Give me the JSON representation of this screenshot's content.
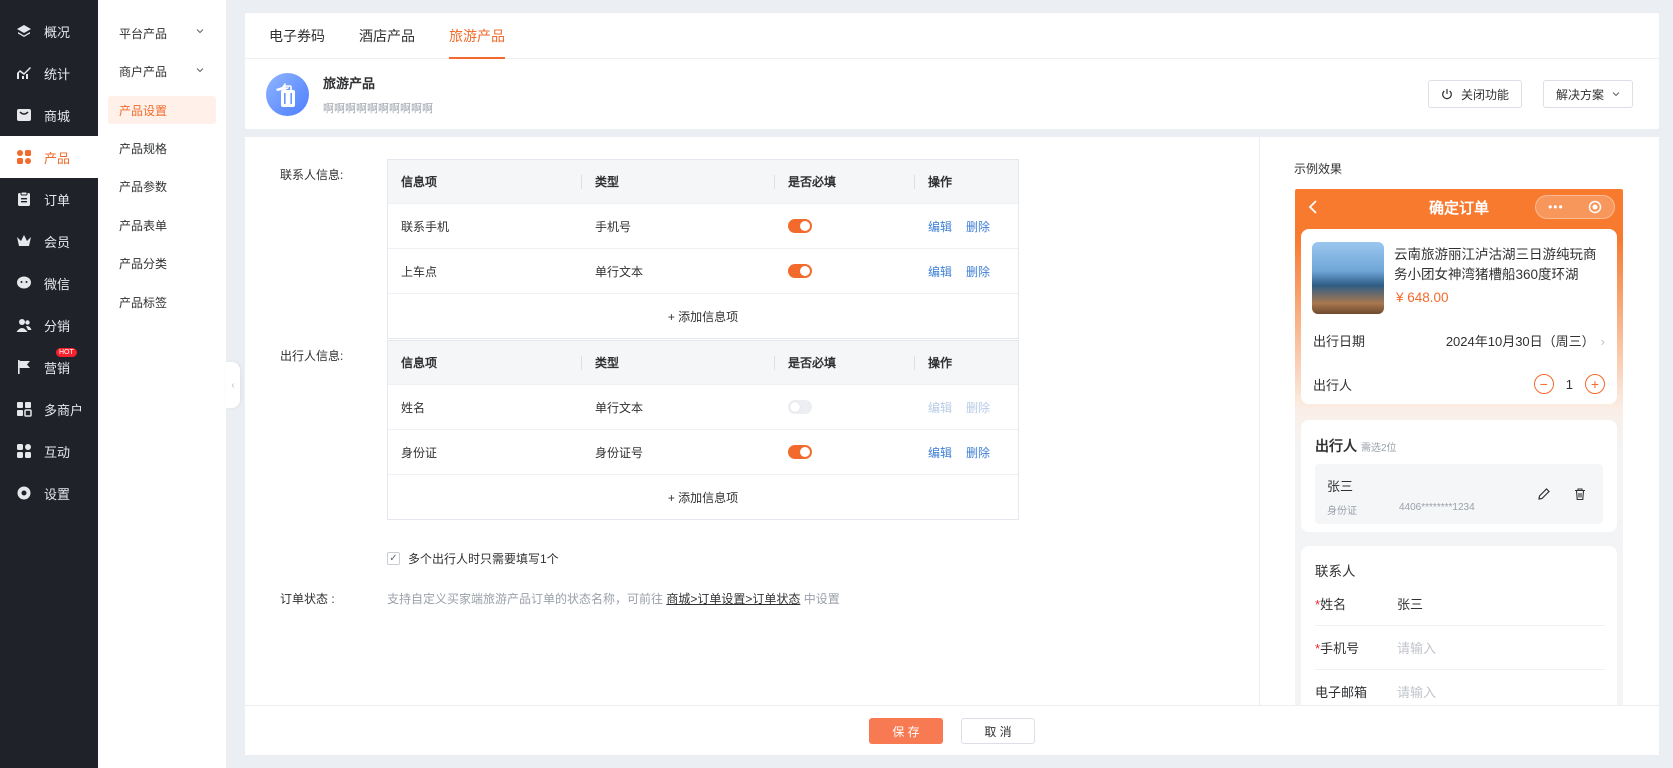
{
  "nav": {
    "items": [
      {
        "label": "概况",
        "icon": "layers-icon"
      },
      {
        "label": "统计",
        "icon": "chart-icon"
      },
      {
        "label": "商城",
        "icon": "shop-icon"
      },
      {
        "label": "产品",
        "icon": "grid-icon",
        "active": true
      },
      {
        "label": "订单",
        "icon": "clipboard-icon"
      },
      {
        "label": "会员",
        "icon": "crown-icon"
      },
      {
        "label": "微信",
        "icon": "wechat-icon"
      },
      {
        "label": "分销",
        "icon": "users-icon"
      },
      {
        "label": "营销",
        "icon": "flag-icon",
        "badge": "HOT"
      },
      {
        "label": "多商户",
        "icon": "store-icon"
      },
      {
        "label": "互动",
        "icon": "apps-icon"
      },
      {
        "label": "设置",
        "icon": "gear-icon"
      }
    ]
  },
  "subnav": {
    "items": [
      "平台产品",
      "商户产品",
      "产品设置",
      "产品规格",
      "产品参数",
      "产品表单",
      "产品分类",
      "产品标签"
    ]
  },
  "tabs": [
    "电子券码",
    "酒店产品",
    "旅游产品"
  ],
  "feature": {
    "title": "旅游产品",
    "desc": "啊啊啊啊啊啊啊啊啊啊",
    "close_label": "关闭功能",
    "plan_label": "解决方案"
  },
  "contact": {
    "label": "联系人信息:",
    "headers": [
      "信息项",
      "类型",
      "是否必填",
      "操作"
    ],
    "rows": [
      {
        "item": "联系手机",
        "type": "手机号",
        "required": true,
        "edit": "编辑",
        "del": "删除"
      },
      {
        "item": "上车点",
        "type": "单行文本",
        "required": true,
        "edit": "编辑",
        "del": "删除"
      }
    ],
    "add": "+ 添加信息项"
  },
  "traveler": {
    "label": "出行人信息:",
    "headers": [
      "信息项",
      "类型",
      "是否必填",
      "操作"
    ],
    "rows": [
      {
        "item": "姓名",
        "type": "单行文本",
        "required": false,
        "edit": "编辑",
        "del": "删除"
      },
      {
        "item": "身份证",
        "type": "身份证号",
        "required": true,
        "edit": "编辑",
        "del": "删除"
      }
    ],
    "add": "+ 添加信息项"
  },
  "multi_check": "多个出行人时只需要填写1个",
  "order_status": {
    "label": "订单状态 :",
    "desc_pre": "支持自定义买家端旅游产品订单的状态名称，可前往 ",
    "link": "商城>订单设置>订单状态",
    "desc_post": " 中设置"
  },
  "preview": {
    "title": "示例效果",
    "bar_title": "确定订单",
    "product_name": "云南旅游丽江泸沽湖三日游纯玩商务小团女神湾猪槽船360度环湖",
    "price": "¥ 648.00",
    "date_label": "出行日期",
    "date_value": "2024年10月30日（周三）",
    "people_label": "出行人",
    "people_count": "1",
    "trav_title": "出行人",
    "trav_hint": "需选2位",
    "trav_name": "张三",
    "trav_id_label": "身份证",
    "trav_id": "4406********1234",
    "contact_title": "联系人",
    "name_label": "姓名",
    "name_value": "张三",
    "phone_label": "手机号",
    "phone_hint": "请输入",
    "email_label": "电子邮箱",
    "email_hint": "请输入"
  },
  "bottom": {
    "save": "保 存",
    "cancel": "取 消"
  },
  "colors": {
    "accent": "#f26b2c",
    "nav_bg": "#1f2329",
    "link": "#3f7fd6"
  }
}
